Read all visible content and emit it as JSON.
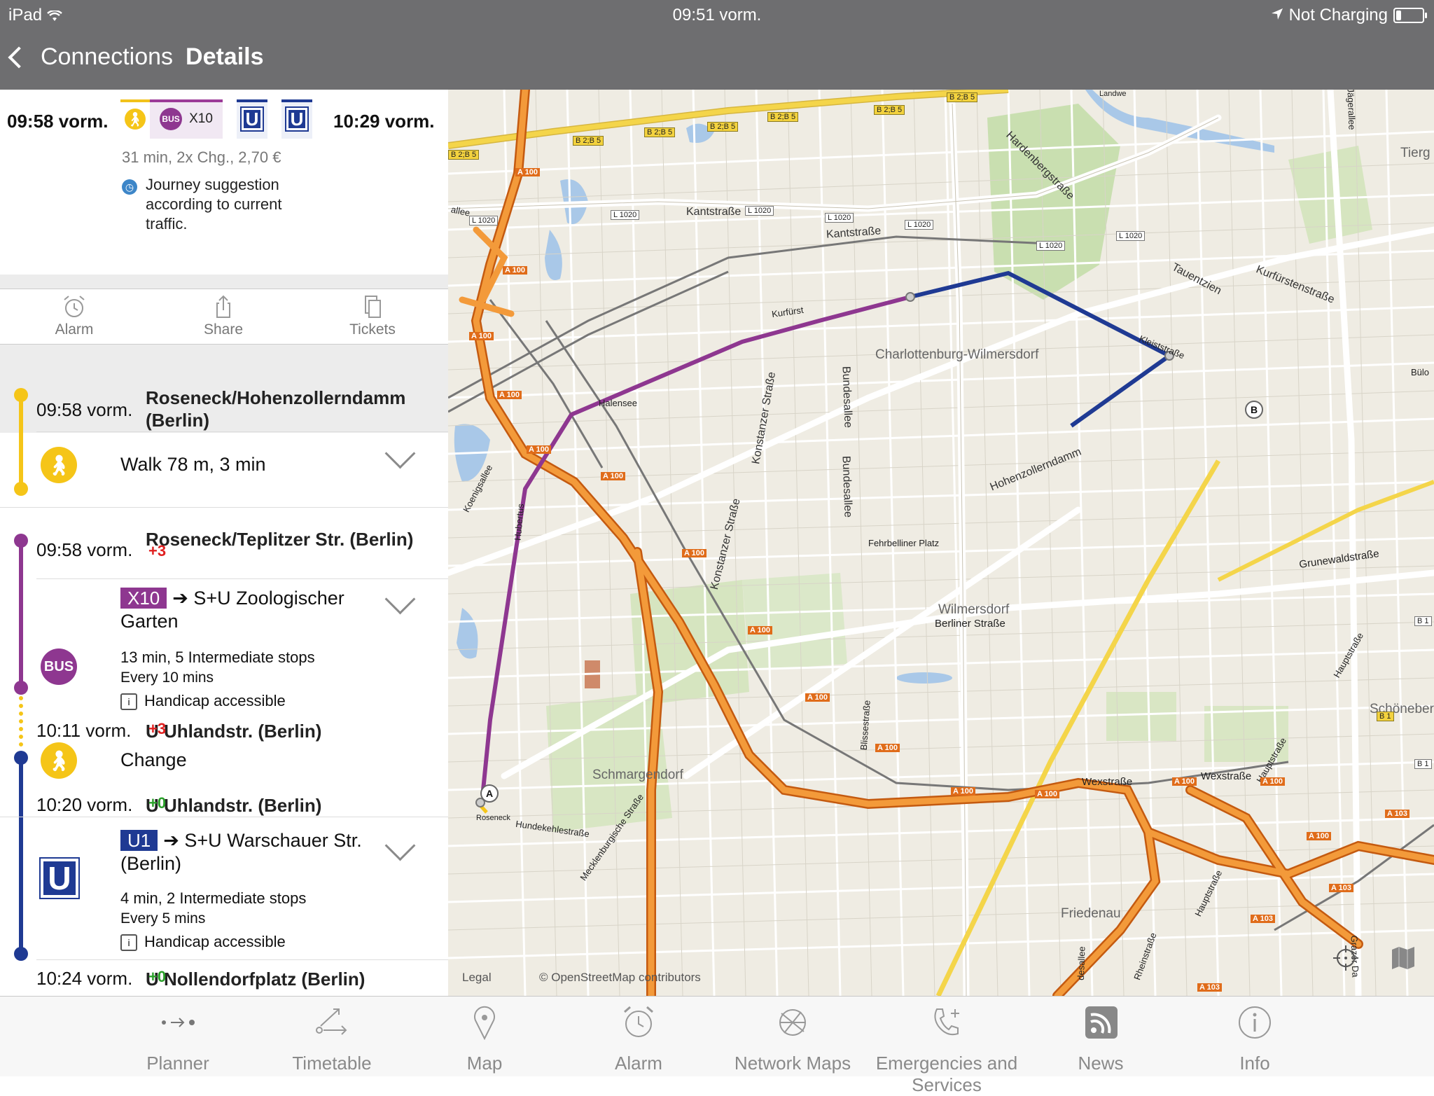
{
  "status": {
    "device": "iPad",
    "time": "09:51 vorm.",
    "battery_text": "Not Charging",
    "battery_level": 0.2
  },
  "nav": {
    "back_label": "Connections",
    "title": "Details"
  },
  "summary": {
    "depart": "09:58 vorm.",
    "arrive": "10:29 vorm.",
    "bus_line": "X10",
    "bus_badge": "BUS",
    "u_badge": "U",
    "meta": "31 min, 2x Chg., 2,70 €",
    "notice": "Journey suggestion according to current traffic."
  },
  "actions": {
    "alarm": "Alarm",
    "share": "Share",
    "tickets": "Tickets"
  },
  "timeline": {
    "stop1": {
      "time": "09:58 vorm.",
      "name": "Roseneck/Hohenzollerndamm (Berlin)"
    },
    "walk1": {
      "text": "Walk 78 m, 3 min"
    },
    "stop2": {
      "time": "09:58 vorm.",
      "name": "Roseneck/Teplitzer Str. (Berlin)",
      "delay": "+3"
    },
    "bus": {
      "badge": "BUS",
      "line": "X10",
      "direction": "S+U Zoologischer Garten",
      "detail": "13 min, 5 Intermediate stops",
      "frequency": "Every 10 mins",
      "access": "Handicap accessible"
    },
    "stop3": {
      "time": "10:11 vorm.",
      "name": "U Uhlandstr. (Berlin)",
      "delay": "+3"
    },
    "change": {
      "text": "Change"
    },
    "stop4": {
      "time": "10:20 vorm.",
      "name": "U Uhlandstr. (Berlin)",
      "delay": "+0"
    },
    "ubahn": {
      "badge": "U",
      "line": "U1",
      "direction": "S+U Warschauer Str. (Berlin)",
      "detail": "4 min, 2 Intermediate stops",
      "frequency": "Every 5 mins",
      "access": "Handicap accessible"
    },
    "stop5": {
      "time": "10:24 vorm.",
      "name": "U Nollendorfplatz (Berlin)",
      "delay": "+0"
    }
  },
  "map": {
    "districts": {
      "charlottenburg": "Charlottenburg-Wilmersdorf",
      "wilmersdorf": "Wilmersdorf",
      "schmargendorf": "Schmargendorf",
      "friedenau": "Friedenau",
      "schoeneberg": "Schöneberg",
      "tiergarten": "Tierg"
    },
    "streets": {
      "kantstr": "Kantstraße",
      "kantstr2": "Kantstraße",
      "kurfuerstenstr": "Kurfürstenstraße",
      "tauentzien": "Tauentzien",
      "hardenberg": "Hardenbergstraße",
      "hohenzollerndamm": "Hohenzollerndamm",
      "konstanzer": "Konstanzer Straße",
      "konstanzer2": "Konstanzer Straße",
      "bundesallee": "Bundesallee",
      "bundesallee2": "Bundesallee",
      "fehrbelliner": "Fehrbelliner Platz",
      "berliner": "Berliner Straße",
      "grunewald": "Grunewaldstraße",
      "wexstr": "Wexstraße",
      "wexstr2": "Wexstraße",
      "hauptstr": "Hauptstraße",
      "hauptstr2": "Hauptstraße",
      "hauptstr3": "Hauptstraße",
      "hundekehle": "Hundekehlestraße",
      "roseneck": "Roseneck",
      "mecklenburg": "Mecklenburgische Straße",
      "blissestr": "Blissestraße",
      "rheinstr": "Rheinstraße",
      "koenigsallee": "Koenigsallee",
      "hubertus": "Hubertus",
      "kurfuerst": "Kurfürst",
      "kleiststr": "Kleiststraße",
      "buelow": "Bülo",
      "grazer": "Grazer Da",
      "allee": "allee",
      "jaegerallee": "Jägerallee",
      "halensee": "Halensee",
      "landwehr": "Landwe",
      "desallee": "desallee"
    },
    "road_labels": {
      "a100": "A 100",
      "a103": "A 103",
      "l1020": "L 1020",
      "b2b5": "B 2;B 5",
      "b1": "B 1"
    },
    "pin_a": "A",
    "pin_b": "B",
    "legal": "Legal",
    "attribution": "© OpenStreetMap contributors"
  },
  "tabs": {
    "planner": "Planner",
    "timetable": "Timetable",
    "map": "Map",
    "alarm": "Alarm",
    "network": "Network Maps",
    "emergencies": "Emergencies and Services",
    "news": "News",
    "info": "Info"
  },
  "colors": {
    "bus": "#8e3790",
    "ubahn": "#1f3a93",
    "walk": "#f5c518",
    "delay_late": "#e02020",
    "delay_ontime": "#2aa02a",
    "bar": "#6e6e70"
  }
}
